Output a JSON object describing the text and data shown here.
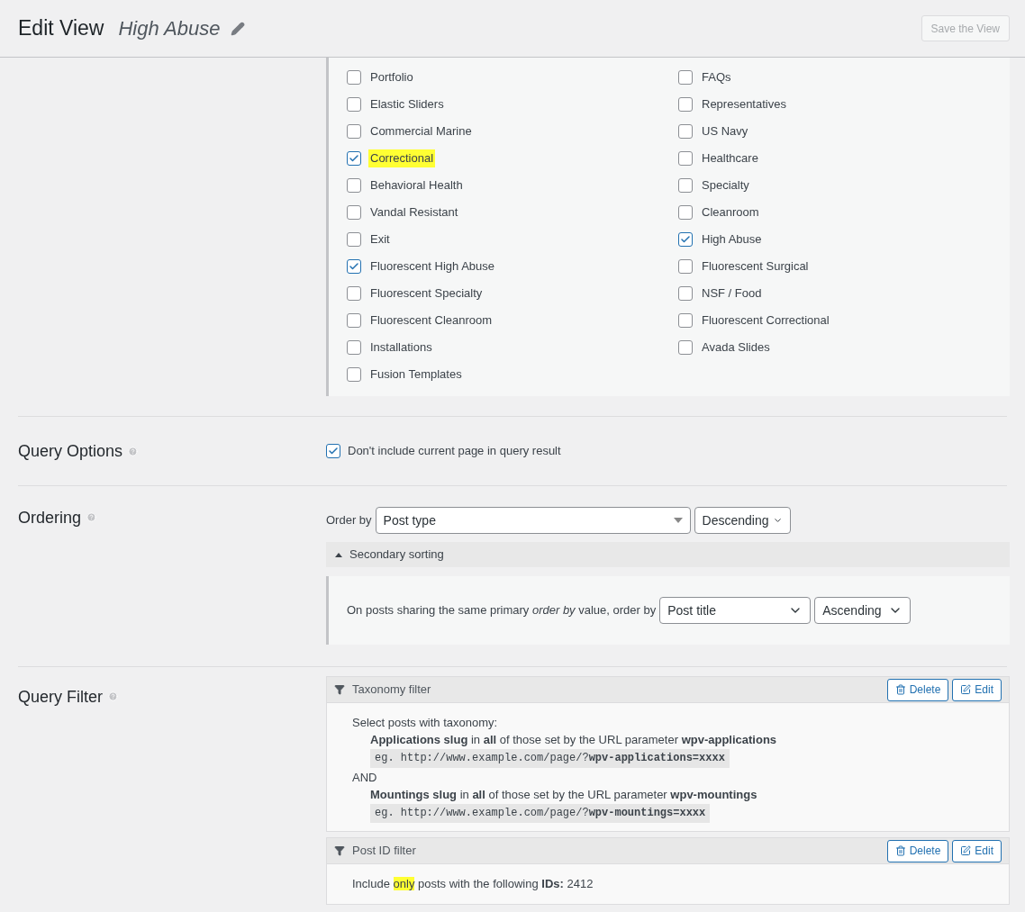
{
  "header": {
    "title": "Edit View",
    "view_name": "High Abuse",
    "save_button": {
      "label": "Save the View",
      "disabled": true
    }
  },
  "taxonomy_terms": [
    {
      "label": "Portfolio",
      "checked": false,
      "highlighted": false
    },
    {
      "label": "FAQs",
      "checked": false,
      "highlighted": false
    },
    {
      "label": "Elastic Sliders",
      "checked": false,
      "highlighted": false
    },
    {
      "label": "Representatives",
      "checked": false,
      "highlighted": false
    },
    {
      "label": "Commercial Marine",
      "checked": false,
      "highlighted": false
    },
    {
      "label": "US Navy",
      "checked": false,
      "highlighted": false
    },
    {
      "label": "Correctional",
      "checked": true,
      "highlighted": true
    },
    {
      "label": "Healthcare",
      "checked": false,
      "highlighted": false
    },
    {
      "label": "Behavioral Health",
      "checked": false,
      "highlighted": false
    },
    {
      "label": "Specialty",
      "checked": false,
      "highlighted": false
    },
    {
      "label": "Vandal Resistant",
      "checked": false,
      "highlighted": false
    },
    {
      "label": "Cleanroom",
      "checked": false,
      "highlighted": false
    },
    {
      "label": "Exit",
      "checked": false,
      "highlighted": false
    },
    {
      "label": "High Abuse",
      "checked": true,
      "highlighted": false
    },
    {
      "label": "Fluorescent High Abuse",
      "checked": true,
      "highlighted": false
    },
    {
      "label": "Fluorescent Surgical",
      "checked": false,
      "highlighted": false
    },
    {
      "label": "Fluorescent Specialty",
      "checked": false,
      "highlighted": false
    },
    {
      "label": "NSF / Food",
      "checked": false,
      "highlighted": false
    },
    {
      "label": "Fluorescent Cleanroom",
      "checked": false,
      "highlighted": false
    },
    {
      "label": "Fluorescent Correctional",
      "checked": false,
      "highlighted": false
    },
    {
      "label": "Installations",
      "checked": false,
      "highlighted": false
    },
    {
      "label": "Avada Slides",
      "checked": false,
      "highlighted": false
    },
    {
      "label": "Fusion Templates",
      "checked": false,
      "highlighted": false
    }
  ],
  "query_options": {
    "label": "Query Options",
    "option": {
      "label": "Don't include current page in query result",
      "checked": true
    }
  },
  "ordering": {
    "label": "Ordering",
    "order_by_label": "Order by",
    "order_by": "Post type",
    "direction": "Descending",
    "secondary": {
      "toggle": "Secondary sorting",
      "expanded": true,
      "sentence": "On posts sharing the same primary *order by* value, order by",
      "order_by": "Post title",
      "direction": "Ascending"
    }
  },
  "query_filter": {
    "label": "Query Filter",
    "filters": [
      {
        "kind": "taxonomy",
        "title": "Taxonomy filter",
        "delete": "Delete",
        "edit": "Edit",
        "intro": "Select posts with taxonomy:",
        "conditions": [
          {
            "text": "**Applications slug** in **all** of those set by the URL parameter **wpv-applications**",
            "example": "eg. http://www.example.com/page/?**wpv-applications=xxxx**"
          },
          {
            "joiner": "AND",
            "text": "**Mountings slug** in **all** of those set by the URL parameter **wpv-mountings**",
            "example": "eg. http://www.example.com/page/?**wpv-mountings=xxxx**"
          }
        ]
      },
      {
        "kind": "post_id",
        "title": "Post ID filter",
        "delete": "Delete",
        "edit": "Edit",
        "text_before": "Include",
        "highlighted": "only",
        "text_after": "posts with the following **IDs:** 2412"
      }
    ]
  }
}
